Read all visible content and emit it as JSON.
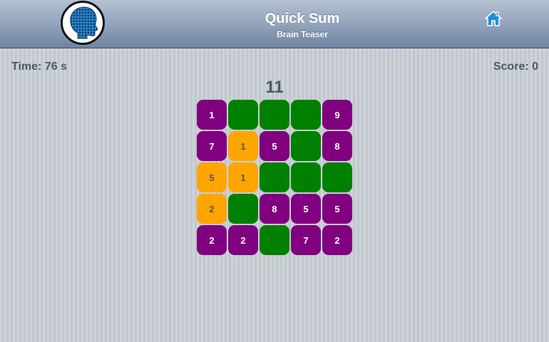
{
  "header": {
    "title": "Quick Sum",
    "subtitle": "Brain Teaser",
    "logo_icon": "head-brain-icon",
    "home_icon": "home-icon"
  },
  "status": {
    "time_text": "Time: 76 s",
    "score_text": "Score: 0"
  },
  "target_sum": "11",
  "colors": {
    "tile_number": "#800080",
    "tile_cleared": "#008000",
    "tile_selected": "#ffa500",
    "header_top": "#b4c1d3",
    "header_bottom": "#6f84a1"
  },
  "board": {
    "rows": [
      [
        {
          "v": "1",
          "s": "purple"
        },
        {
          "v": "",
          "s": "green"
        },
        {
          "v": "",
          "s": "green"
        },
        {
          "v": "",
          "s": "green"
        },
        {
          "v": "9",
          "s": "purple"
        }
      ],
      [
        {
          "v": "7",
          "s": "purple"
        },
        {
          "v": "1",
          "s": "orange"
        },
        {
          "v": "5",
          "s": "purple"
        },
        {
          "v": "",
          "s": "green"
        },
        {
          "v": "8",
          "s": "purple"
        }
      ],
      [
        {
          "v": "5",
          "s": "orange"
        },
        {
          "v": "1",
          "s": "orange"
        },
        {
          "v": "",
          "s": "green"
        },
        {
          "v": "",
          "s": "green"
        },
        {
          "v": "",
          "s": "green"
        }
      ],
      [
        {
          "v": "2",
          "s": "orange"
        },
        {
          "v": "",
          "s": "green"
        },
        {
          "v": "8",
          "s": "purple"
        },
        {
          "v": "5",
          "s": "purple"
        },
        {
          "v": "5",
          "s": "purple"
        }
      ],
      [
        {
          "v": "2",
          "s": "purple"
        },
        {
          "v": "2",
          "s": "purple"
        },
        {
          "v": "",
          "s": "green"
        },
        {
          "v": "7",
          "s": "purple"
        },
        {
          "v": "2",
          "s": "purple"
        }
      ]
    ]
  }
}
